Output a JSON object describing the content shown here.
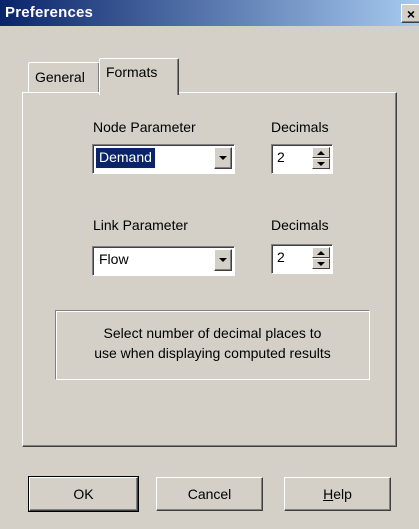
{
  "window": {
    "title": "Preferences",
    "close_glyph": "×"
  },
  "tabs": [
    {
      "label": "General",
      "active": false
    },
    {
      "label": "Formats",
      "active": true
    }
  ],
  "node": {
    "label": "Node Parameter",
    "value": "Demand",
    "decimals_label": "Decimals",
    "decimals": "2"
  },
  "link": {
    "label": "Link Parameter",
    "value": "Flow",
    "decimals_label": "Decimals",
    "decimals": "2"
  },
  "info": {
    "line1": "Select number of decimal places to",
    "line2": "use when displaying computed results"
  },
  "buttons": {
    "ok": "OK",
    "cancel": "Cancel",
    "help": "Help"
  },
  "icons": {
    "close": "close-icon",
    "dropdown": "chevron-down-icon",
    "spin_up": "arrow-up-icon",
    "spin_down": "arrow-down-icon"
  },
  "colors": {
    "titlebar": "#0a246a",
    "face": "#d4d0c8",
    "selection": "#0a246a"
  }
}
